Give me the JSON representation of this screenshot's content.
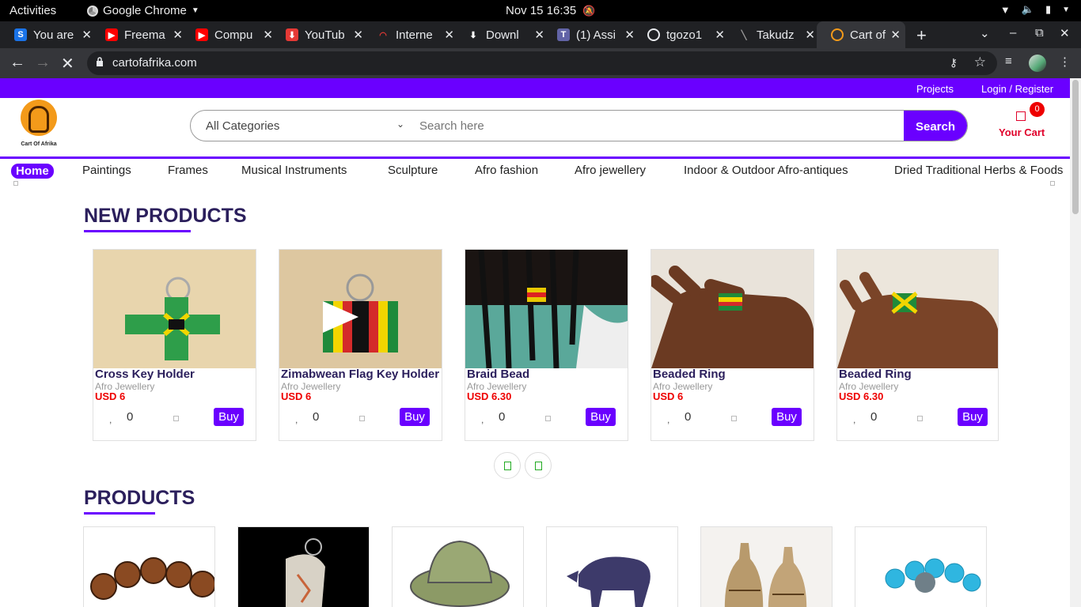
{
  "system_bar": {
    "activities": "Activities",
    "app_name": "Google Chrome",
    "clock": "Nov 15  16:35"
  },
  "tabs": [
    {
      "title": "You are",
      "favicon": "S",
      "color": "#1a73e8"
    },
    {
      "title": "Freema",
      "favicon": "youtube-icon",
      "color": "#ff0000"
    },
    {
      "title": "Compu",
      "favicon": "youtube-icon",
      "color": "#ff0000"
    },
    {
      "title": "YouTub",
      "favicon": "download-icon",
      "color": "#e53935"
    },
    {
      "title": "Interne",
      "favicon": "gauge-icon",
      "color": "#e53935"
    },
    {
      "title": "Downl",
      "favicon": "download-arrow-icon",
      "color": "#e8eaed"
    },
    {
      "title": "(1) Assi",
      "favicon": "teams-icon",
      "color": "#6264a7"
    },
    {
      "title": "tgozo1",
      "favicon": "github-icon",
      "color": "#e8eaed"
    },
    {
      "title": "Takudz",
      "favicon": "feather-icon",
      "color": "#999999"
    },
    {
      "title": "Cart of",
      "favicon": "cart-of-afrika-icon",
      "color": "#f39a1a"
    }
  ],
  "browser": {
    "url": "cartofafrika.com"
  },
  "site": {
    "top_links": {
      "projects": "Projects",
      "login": "Login / Register"
    },
    "logo_text": "Cart Of Afrika",
    "search": {
      "category": "All Categories",
      "placeholder": "Search here",
      "button": "Search"
    },
    "cart": {
      "count": "0",
      "label": "Your Cart"
    },
    "nav": [
      "Home",
      "Paintings",
      "Frames",
      "Musical Instruments",
      "Sculpture",
      "Afro fashion",
      "Afro jewellery",
      "Indoor & Outdoor Afro-antiques",
      "Dried Traditional Herbs & Foods"
    ],
    "new_products_title": "NEW PRODUCTS",
    "new_products": [
      {
        "name": "Cross Key Holder",
        "category": "Afro Jewellery",
        "price": "USD 6",
        "qty": "0",
        "buy": "Buy"
      },
      {
        "name": "Zimabwean Flag Key Holder",
        "category": "Afro Jewellery",
        "price": "USD 6",
        "qty": "0",
        "buy": "Buy"
      },
      {
        "name": "Braid Bead",
        "category": "Afro Jewellery",
        "price": "USD 6.30",
        "qty": "0",
        "buy": "Buy"
      },
      {
        "name": "Beaded Ring",
        "category": "Afro Jewellery",
        "price": "USD 6",
        "qty": "0",
        "buy": "Buy"
      },
      {
        "name": "Beaded Ring",
        "category": "Afro Jewellery",
        "price": "USD 6.30",
        "qty": "0",
        "buy": "Buy"
      }
    ],
    "products_title": "PRODUCTS",
    "accent_color": "#6a00ff",
    "price_color": "#ee0000"
  }
}
